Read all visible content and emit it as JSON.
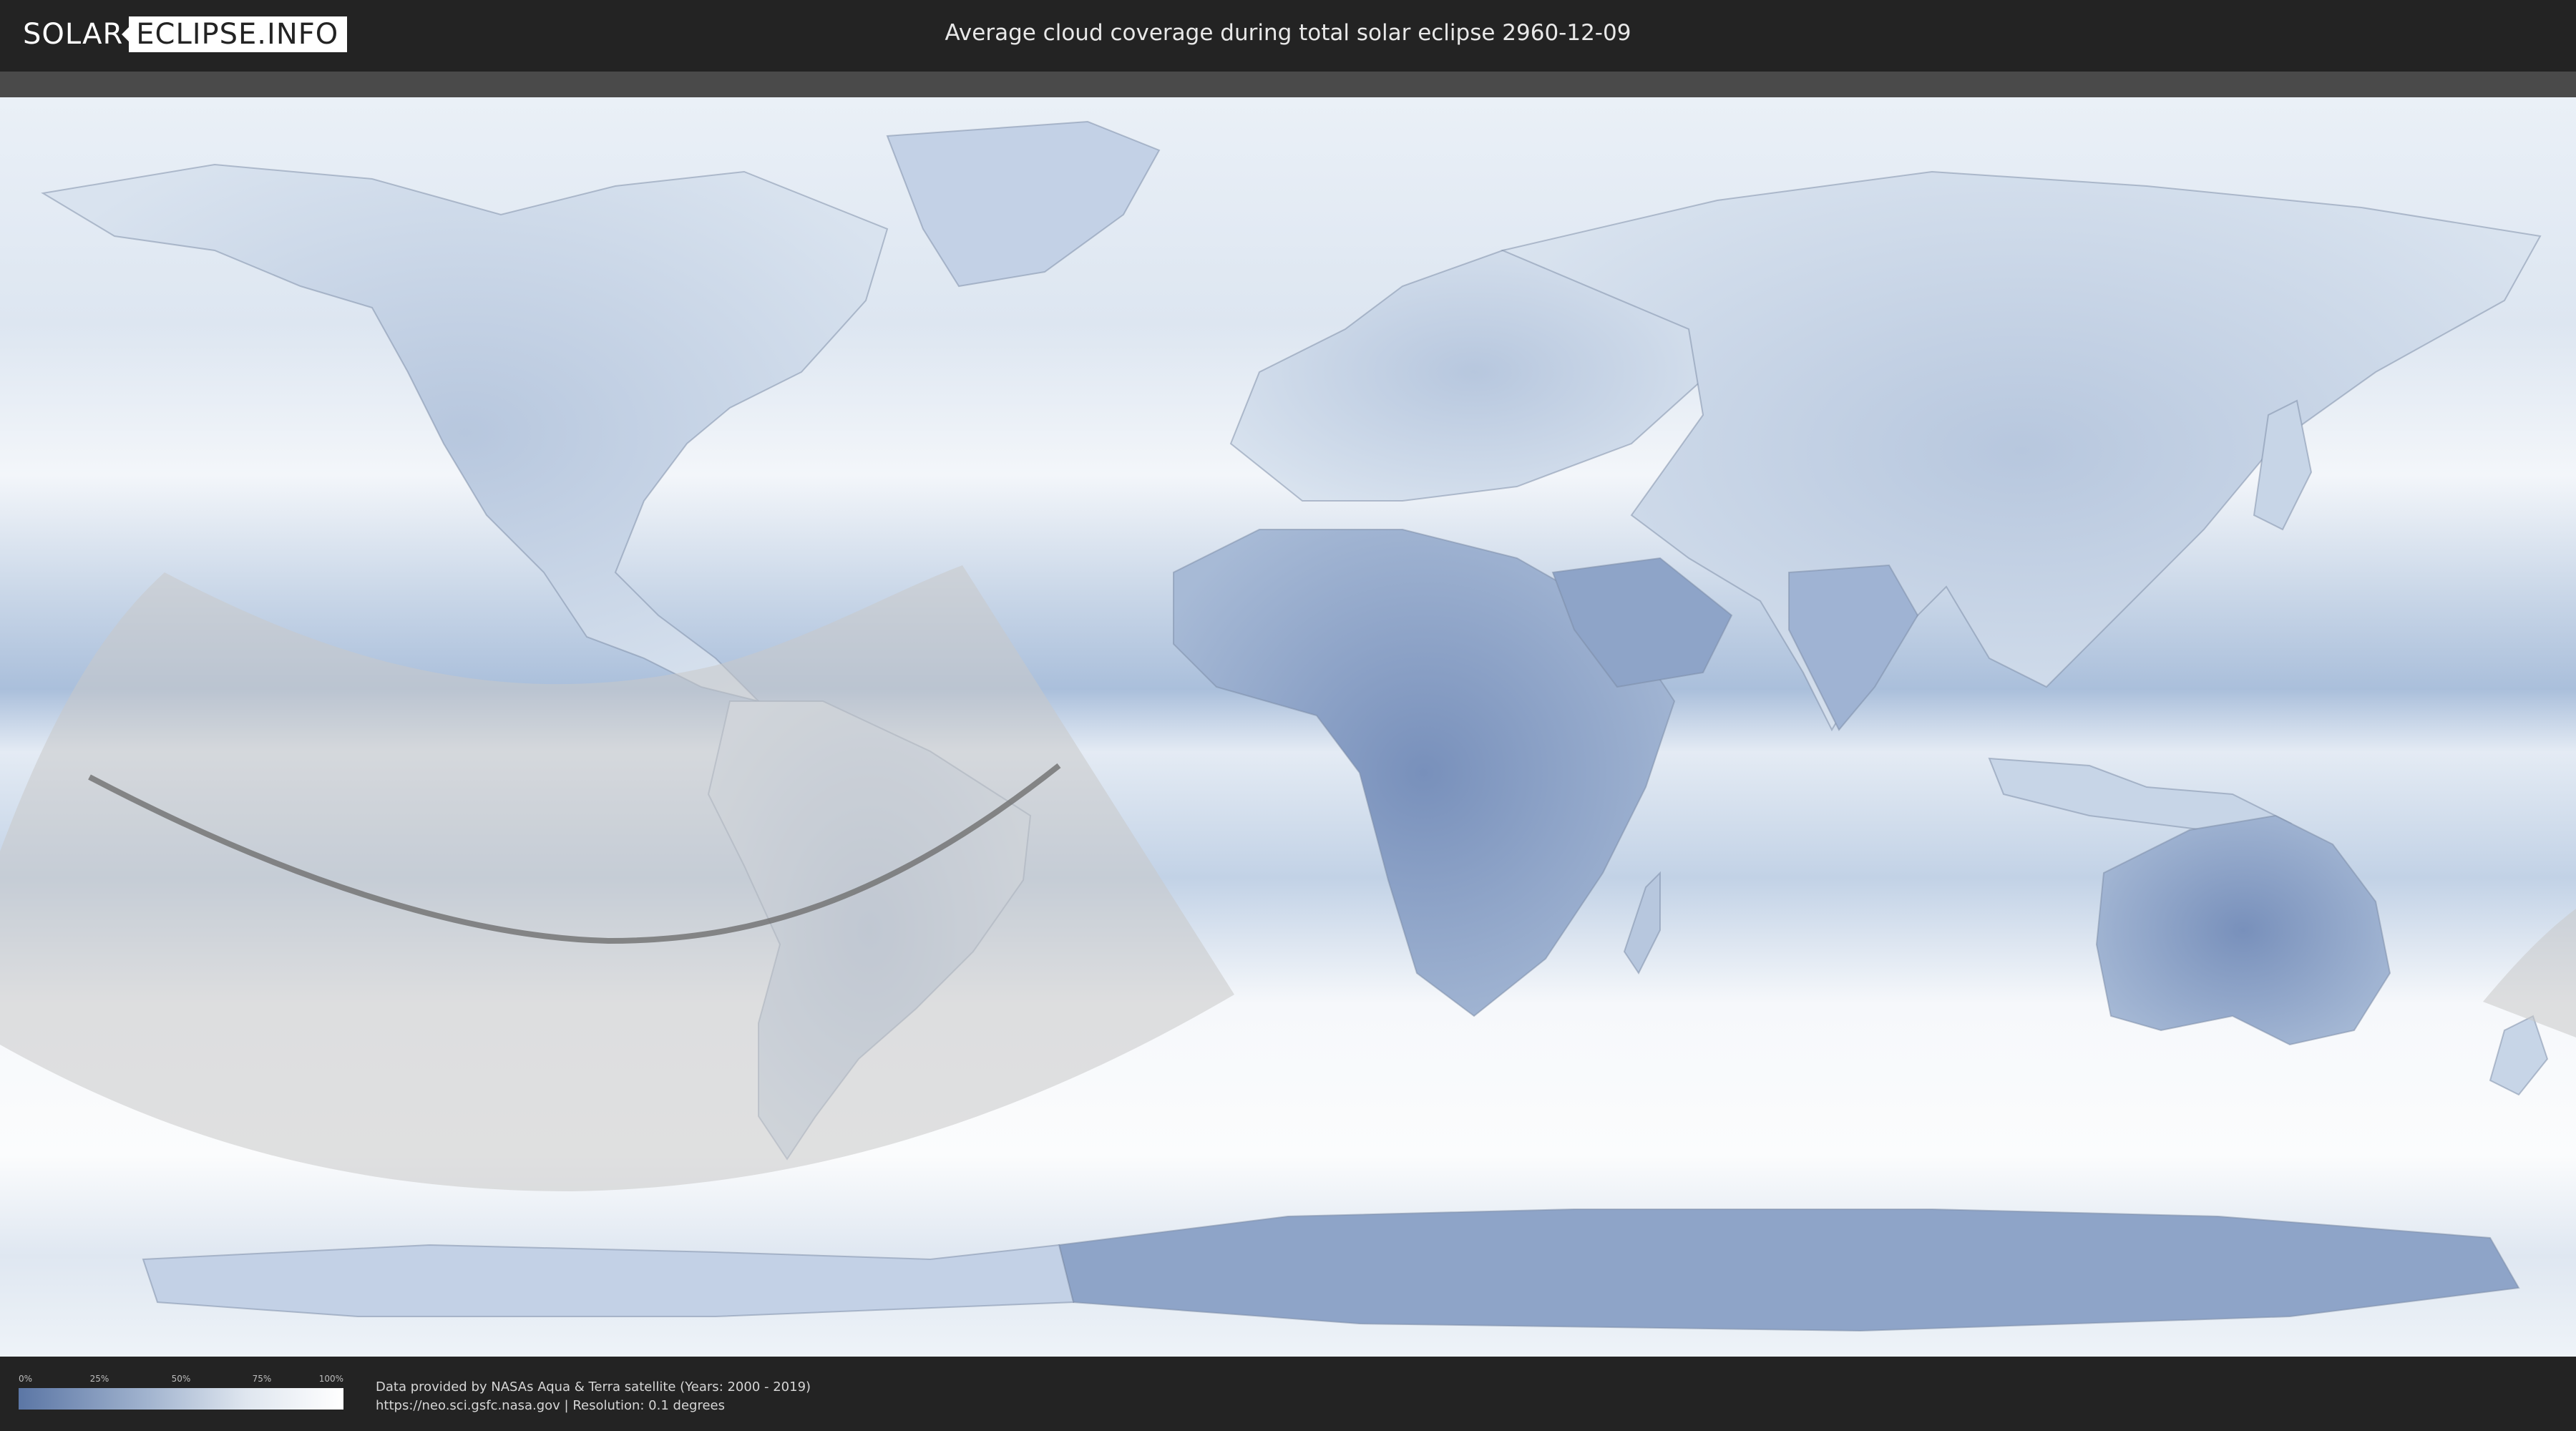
{
  "header": {
    "logo_left": "SOLAR",
    "logo_right": "ECLIPSE.INFO",
    "title": "Average cloud coverage during total solar eclipse 2960-12-09"
  },
  "legend": {
    "ticks": [
      "0%",
      "25%",
      "50%",
      "75%",
      "100%"
    ],
    "colors": {
      "low": "#5b76a5",
      "high": "#ffffff"
    }
  },
  "credits": {
    "line1": "Data provided by NASAs Aqua & Terra satellite (Years: 2000 - 2019)",
    "line2": "https://neo.sci.gsfc.nasa.gov | Resolution: 0.1 degrees"
  },
  "map": {
    "colors": {
      "ocean_clouds": "#eef3f8",
      "clear_band": "#b6c8df",
      "land_clear": "#7f98c0",
      "eclipse_shadow": "#c8c8c8",
      "central_line": "#6f6f6f"
    }
  }
}
